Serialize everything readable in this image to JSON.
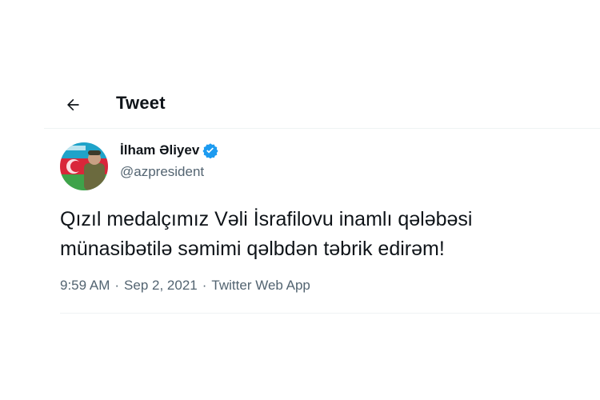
{
  "header": {
    "title": "Tweet"
  },
  "tweet": {
    "author_name": "İlham Əliyev",
    "handle": "@azpresident",
    "text_lines": [
      "Qızıl medalçımız Vəli İsrafilovu inamlı qələbəsi",
      "münasibətilə səmimi qəlbdən təbrik edirəm!"
    ],
    "time": "9:59 AM",
    "date": "Sep 2, 2021",
    "separator": "·",
    "source": "Twitter Web App"
  },
  "colors": {
    "verified": "#1d9bf0",
    "secondary_text": "#536471",
    "divider": "#eff3f4"
  },
  "icons": {
    "back": "back-arrow-icon",
    "verified": "verified-badge-icon"
  }
}
